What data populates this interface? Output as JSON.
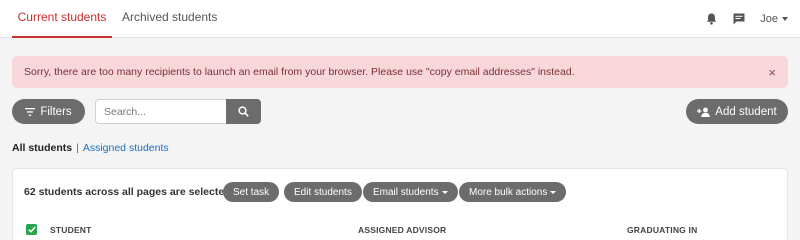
{
  "tabs": {
    "current": "Current students",
    "archived": "Archived students"
  },
  "topbar": {
    "user_name": "Joe",
    "icons": [
      "bell-icon",
      "chat-icon"
    ]
  },
  "alert": {
    "message": "Sorry, there are too many recipients to launch an email from your browser. Please use \"copy email addresses\" instead.",
    "close_symbol": "×"
  },
  "toolbar": {
    "filters_label": "Filters",
    "search_placeholder": "Search...",
    "search_value": "",
    "add_student_label": "Add student"
  },
  "views": {
    "all": "All students",
    "separator": "|",
    "assigned": "Assigned students"
  },
  "selection": {
    "summary": "62 students across all pages are selected",
    "actions": {
      "set_task": "Set task",
      "edit_students": "Edit students",
      "email_students": "Email students",
      "more_bulk_actions": "More bulk actions"
    }
  },
  "table": {
    "all_selected": true,
    "columns": [
      "STUDENT",
      "ASSIGNED ADVISOR",
      "GRADUATING IN"
    ]
  },
  "colors": {
    "accent": "#c9302c",
    "alert_bg": "#f8d7da",
    "button_grey": "#6c6c6c",
    "link_blue": "#1a6fc2",
    "checkbox_green": "#2aa44f"
  }
}
